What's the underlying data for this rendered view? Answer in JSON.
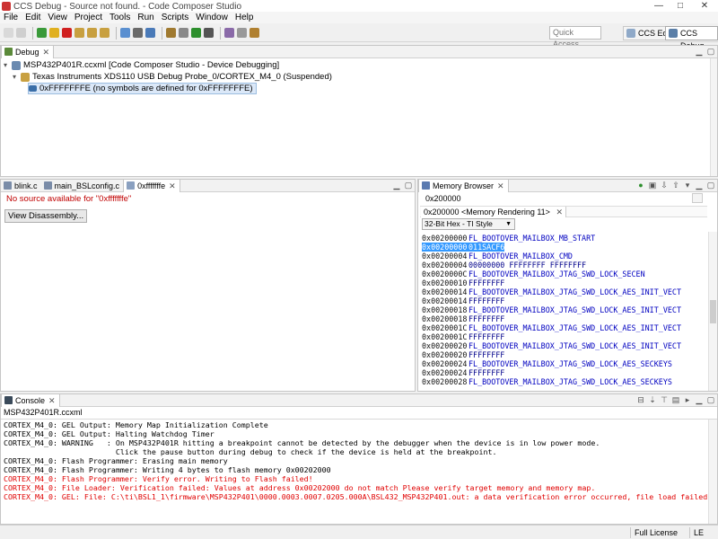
{
  "window": {
    "title": "CCS Debug - Source not found. - Code Composer Studio",
    "min": "—",
    "max": "□",
    "close": "✕"
  },
  "menu": [
    "File",
    "Edit",
    "View",
    "Project",
    "Tools",
    "Run",
    "Scripts",
    "Window",
    "Help"
  ],
  "toolbar": {
    "quick_access": "Quick Access",
    "perspectives": [
      {
        "label": "CCS Edit"
      },
      {
        "label": "CCS Debug"
      }
    ]
  },
  "debug_view": {
    "tab_label": "Debug",
    "tree": [
      {
        "level": 0,
        "label": "MSP432P401R.ccxml [Code Composer Studio - Device Debugging]",
        "icon": "ccxml-icon"
      },
      {
        "level": 1,
        "label": "Texas Instruments XDS110 USB Debug Probe_0/CORTEX_M4_0 (Suspended)",
        "icon": "thread-icon"
      },
      {
        "level": 2,
        "label": "0xFFFFFFFE  (no symbols are defined for 0xFFFFFFFE)",
        "icon": "stack-frame-icon",
        "selected": true
      }
    ]
  },
  "editor": {
    "tabs": [
      {
        "label": "blink.c"
      },
      {
        "label": "main_BSLconfig.c"
      },
      {
        "label": "0xfffffffe",
        "active": true
      }
    ],
    "message": "No source available for \"0xfffffffe\"",
    "button": "View Disassembly..."
  },
  "memory": {
    "tab_label": "Memory Browser",
    "address_value": "0x200000",
    "rendering_tab": "0x200000 <Memory Rendering 11>",
    "format": "32-Bit Hex - TI Style",
    "rows": [
      {
        "addr": "0x00200000",
        "val": "FL_BOOTOVER_MAILBOX_MB_START",
        "sym": true
      },
      {
        "addr": "0x00200000",
        "val": "011SACF6",
        "selected": true
      },
      {
        "addr": "0x00200004",
        "val": "FL_BOOTOVER_MAILBOX_CMD",
        "sym": true
      },
      {
        "addr": "0x00200004",
        "val": "00000000 FFFFFFFF FFFFFFFF"
      },
      {
        "addr": "0x0020000C",
        "val": "FL_BOOTOVER_MAILBOX_JTAG_SWD_LOCK_SECEN",
        "sym": true
      },
      {
        "addr": "0x00200010",
        "val": "FFFFFFFF"
      },
      {
        "addr": "0x00200014",
        "val": "FL_BOOTOVER_MAILBOX_JTAG_SWD_LOCK_AES_INIT_VECT",
        "sym": true
      },
      {
        "addr": "0x00200014",
        "val": "FFFFFFFF"
      },
      {
        "addr": "0x00200018",
        "val": "FL_BOOTOVER_MAILBOX_JTAG_SWD_LOCK_AES_INIT_VECT",
        "sym": true
      },
      {
        "addr": "0x00200018",
        "val": "FFFFFFFF"
      },
      {
        "addr": "0x0020001C",
        "val": "FL_BOOTOVER_MAILBOX_JTAG_SWD_LOCK_AES_INIT_VECT",
        "sym": true
      },
      {
        "addr": "0x0020001C",
        "val": "FFFFFFFF"
      },
      {
        "addr": "0x00200020",
        "val": "FL_BOOTOVER_MAILBOX_JTAG_SWD_LOCK_AES_INIT_VECT",
        "sym": true
      },
      {
        "addr": "0x00200020",
        "val": "FFFFFFFF"
      },
      {
        "addr": "0x00200024",
        "val": "FL_BOOTOVER_MAILBOX_JTAG_SWD_LOCK_AES_SECKEYS",
        "sym": true
      },
      {
        "addr": "0x00200024",
        "val": "FFFFFFFF"
      },
      {
        "addr": "0x00200028",
        "val": "FL_BOOTOVER_MAILBOX_JTAG_SWD_LOCK_AES_SECKEYS",
        "sym": true
      }
    ]
  },
  "console": {
    "tab_label": "Console",
    "source": "MSP432P401R.ccxml",
    "lines": [
      {
        "text": "CORTEX_M4_0: GEL Output: Memory Map Initialization Complete",
        "error": false
      },
      {
        "text": "CORTEX_M4_0: GEL Output: Halting Watchdog Timer",
        "error": false
      },
      {
        "text": "CORTEX_M4_0: WARNING   : On MSP432P401R hitting a breakpoint cannot be detected by the debugger when the device is in low power mode.",
        "error": false
      },
      {
        "text": "                         Click the pause button during debug to check if the device is held at the breakpoint.",
        "error": false
      },
      {
        "text": "CORTEX_M4_0: Flash Programmer: Erasing main memory",
        "error": false
      },
      {
        "text": "CORTEX_M4_0: Flash Programmer: Writing 4 bytes to flash memory 0x00202000",
        "error": false
      },
      {
        "text": "CORTEX_M4_0: Flash Programmer: Verify error. Writing to Flash failed!",
        "error": true
      },
      {
        "text": "CORTEX_M4_0: File Loader: Verification failed: Values at address 0x00202000 do not match Please verify target memory and memory map.",
        "error": true
      },
      {
        "text": "CORTEX_M4_0: GEL: File: C:\\ti\\BSL1_1\\firmware\\MSP432P401\\0000.0003.0007.0205.000A\\BSL432_MSP432P401.out: a data verification error occurred, file load failed.",
        "error": true
      }
    ]
  },
  "status": {
    "license": "Full License",
    "encoding": "LE"
  }
}
